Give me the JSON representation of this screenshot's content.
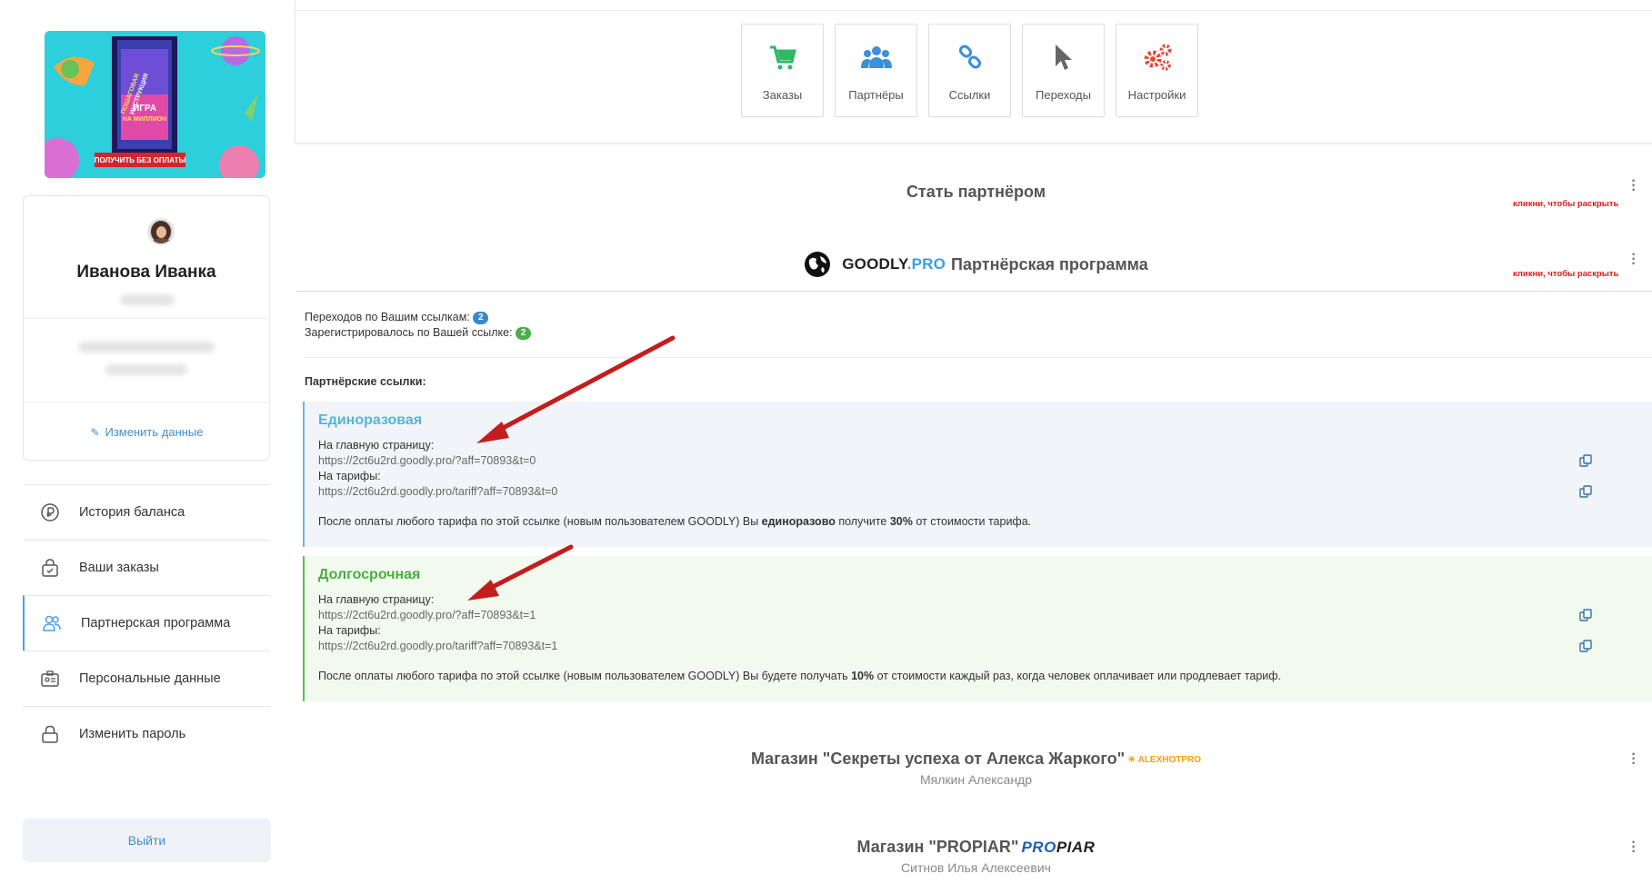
{
  "sidebar": {
    "banner": {
      "title_line1": "ПОШАГОВАЯ",
      "title_line2": "ИНСТРУКЦИЯ",
      "game_line1": "ИГРА",
      "game_line2": "НА МИЛЛИОН",
      "cta": "ПОЛУЧИТЬ БЕЗ ОПЛАТЫ"
    },
    "profile": {
      "name": "Иванова Иванка",
      "edit_label": "Изменить данные"
    },
    "menu": [
      {
        "label": "История баланса",
        "icon": "ruble-icon"
      },
      {
        "label": "Ваши заказы",
        "icon": "shopping-bag-icon"
      },
      {
        "label": "Партнерская программа",
        "icon": "partners-icon",
        "active": true
      },
      {
        "label": "Персональные данные",
        "icon": "id-card-icon"
      },
      {
        "label": "Изменить пароль",
        "icon": "lock-icon"
      }
    ],
    "logout_label": "Выйти"
  },
  "toolbar": {
    "tiles": [
      {
        "label": "Заказы",
        "icon": "cart-icon",
        "color": "#2fb865"
      },
      {
        "label": "Партнёры",
        "icon": "users-icon",
        "color": "#3d8fd8"
      },
      {
        "label": "Ссылки",
        "icon": "link-icon",
        "color": "#3d8fd8"
      },
      {
        "label": "Переходы",
        "icon": "cursor-icon",
        "color": "#666666"
      },
      {
        "label": "Настройки",
        "icon": "gears-icon",
        "color": "#e04a3a"
      }
    ]
  },
  "become_partner": {
    "title": "Стать партнёром",
    "hint": "кликни, чтобы раскрыть"
  },
  "program": {
    "brand_main": "GOODLY",
    "brand_pro": ".PRO",
    "title": "Партнёрская программа",
    "hint": "кликни, чтобы раскрыть",
    "stats": {
      "visits_label": "Переходов по Вашим ссылкам:",
      "visits_count": "2",
      "registered_label": "Зарегистрировалось по Вашей ссылке:",
      "registered_count": "2"
    },
    "links_title": "Партнёрские ссылки:",
    "one_time": {
      "title": "Единоразовая",
      "main_label": "На главную страницу:",
      "main_url": "https://2ct6u2rd.goodly.pro/?aff=70893&t=0",
      "tariff_label": "На тарифы:",
      "tariff_url": "https://2ct6u2rd.goodly.pro/tariff?aff=70893&t=0",
      "desc_before": "После оплаты любого тарифа по этой ссылке (новым пользователем GOODLY) Вы ",
      "desc_bold1": "единоразово",
      "desc_mid": " получите ",
      "desc_bold2": "30%",
      "desc_after": " от стоимости тарифа."
    },
    "long_term": {
      "title": "Долгосрочная",
      "main_label": "На главную страницу:",
      "main_url": "https://2ct6u2rd.goodly.pro/?aff=70893&t=1",
      "tariff_label": "На тарифы:",
      "tariff_url": "https://2ct6u2rd.goodly.pro/tariff?aff=70893&t=1",
      "desc_before": "После оплаты любого тарифа по этой ссылке (новым пользователем GOODLY) Вы будете получать ",
      "desc_bold": "10%",
      "desc_after": " от стоимости каждый раз, когда человек оплачивает или продлевает тариф."
    }
  },
  "shops": [
    {
      "title": "Магазин \"Секреты успеха от Алекса Жаркого\"",
      "logo": "ALEXHOTPRO",
      "owner": "Мялкин Александр"
    },
    {
      "title": "Магазин \"PROPIAR\"",
      "logo_a": "PRO",
      "logo_b": "PIAR",
      "owner": "Ситнов Илья Алексеевич"
    }
  ],
  "colors": {
    "accent": "#3f8ed1",
    "hint_red": "#e0191b",
    "one_time_title": "#57b3dc",
    "long_term_title": "#4aae3e",
    "arrow_red": "#c41d1d"
  }
}
